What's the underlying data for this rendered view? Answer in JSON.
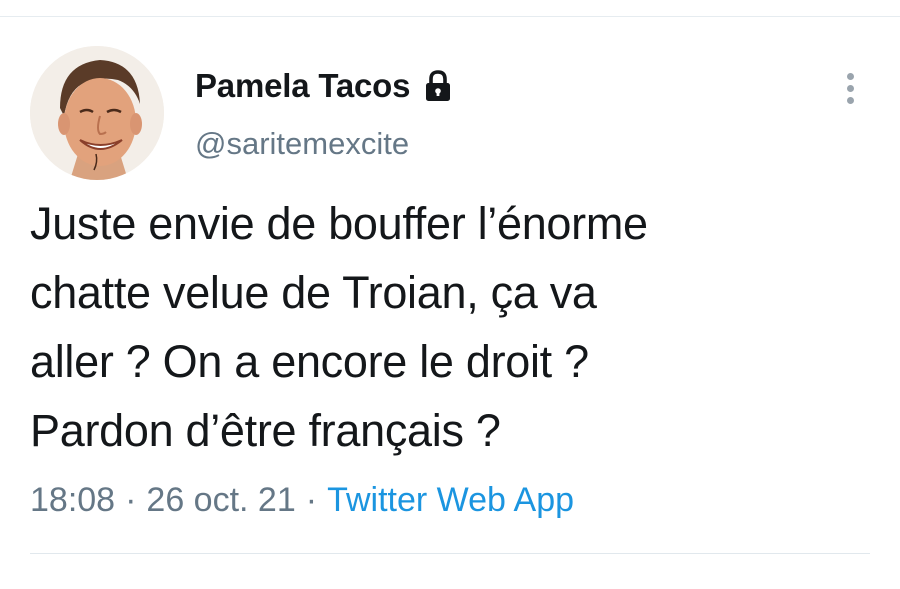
{
  "author": {
    "display_name": "Pamela Tacos",
    "handle": "@saritemexcite",
    "protected_icon": "lock-icon",
    "avatar_icon": "profile-photo"
  },
  "tweet": {
    "text": "Juste envie de bouffer l’énorme\nchatte velue de Troian, ça va\naller ? On a encore le droit ?\nPardon d’être français ?"
  },
  "meta": {
    "time": "18:08",
    "separator": "·",
    "date": "26 oct. 21",
    "source": "Twitter Web App"
  },
  "menu": {
    "icon": "more-vertical-icon"
  },
  "colors": {
    "text": "#14171a",
    "secondary": "#657786",
    "link": "#1b95e0",
    "divider": "#e1e8ed"
  }
}
